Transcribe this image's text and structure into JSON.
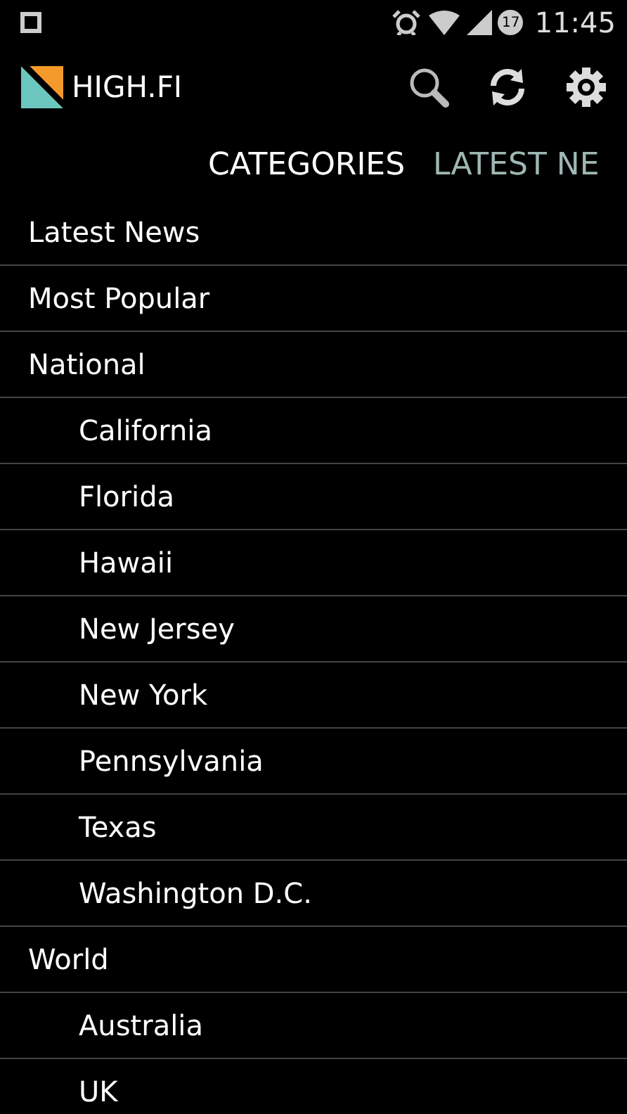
{
  "status_bar": {
    "notification_count": "17",
    "time": "11:45"
  },
  "app_bar": {
    "title": "HIGH.FI"
  },
  "tabs": [
    {
      "label": "CATEGORIES",
      "selected": true
    },
    {
      "label": "LATEST NE",
      "selected": false
    }
  ],
  "categories": [
    {
      "label": "Latest News"
    },
    {
      "label": "Most Popular"
    },
    {
      "label": "National",
      "children": [
        {
          "label": "California"
        },
        {
          "label": "Florida"
        },
        {
          "label": "Hawaii"
        },
        {
          "label": "New Jersey"
        },
        {
          "label": "New York"
        },
        {
          "label": "Pennsylvania"
        },
        {
          "label": "Texas"
        },
        {
          "label": "Washington D.C."
        }
      ]
    },
    {
      "label": "World",
      "children": [
        {
          "label": "Australia"
        },
        {
          "label": "UK"
        }
      ]
    }
  ]
}
